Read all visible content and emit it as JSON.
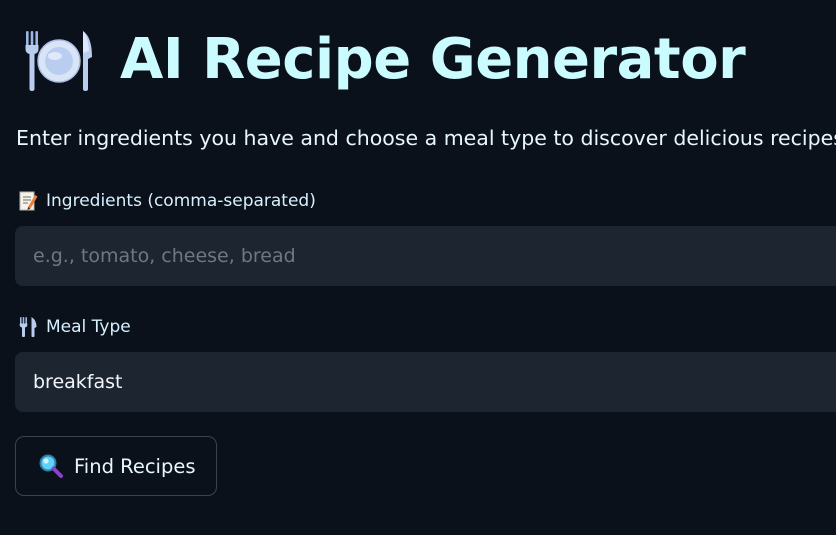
{
  "header": {
    "icon": "plate-cutlery-icon",
    "title": "AI Recipe Generator",
    "subtitle": "Enter ingredients you have and choose a meal type to discover delicious recipes!"
  },
  "ingredients": {
    "icon": "memo-icon",
    "label": "Ingredients (comma-separated)",
    "value": "",
    "placeholder": "e.g., tomato, cheese, bread"
  },
  "meal_type": {
    "icon": "fork-knife-icon",
    "label": "Meal Type",
    "value": "breakfast"
  },
  "find_button": {
    "icon": "magnifier-icon",
    "label": "Find Recipes"
  },
  "colors": {
    "background": "#0b111a",
    "title": "#c9fbff",
    "field_background": "#1d2531",
    "placeholder": "#6c7886"
  }
}
